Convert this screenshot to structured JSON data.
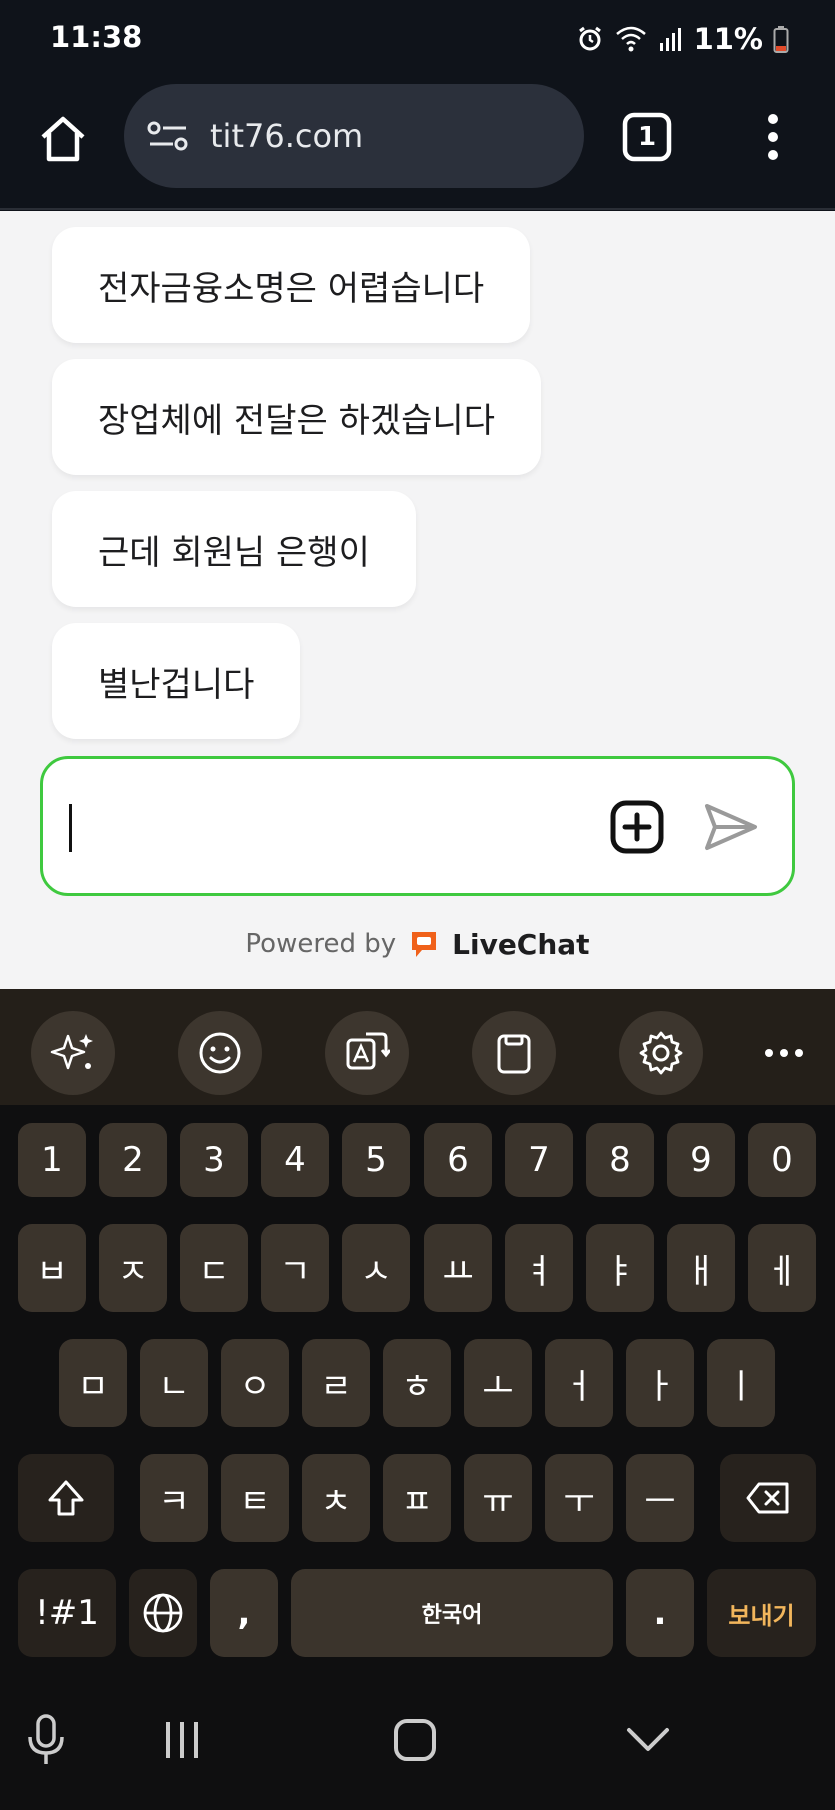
{
  "status": {
    "time": "11:38",
    "battery": "11%",
    "icons": [
      "alarm-icon",
      "wifi-icon",
      "signal-icon",
      "battery-icon"
    ]
  },
  "browser": {
    "url": "tit76.com",
    "tab_count": "1",
    "icons": [
      "home-icon",
      "site-settings-icon",
      "tabs-icon",
      "more-menu-icon"
    ]
  },
  "chat": {
    "messages": [
      {
        "text": "전자금융소명은 어렵습니다"
      },
      {
        "text": "장업체에 전달은 하겠습니다"
      },
      {
        "text": "근데 회원님 은행이"
      },
      {
        "text": "별난겁니다"
      }
    ],
    "input_value": "",
    "powered_by": "Powered by",
    "brand": "LiveChat",
    "colors": {
      "input_border": "#3fc93f",
      "brand": "#f0611a",
      "send_icon": "#9a9a9a"
    }
  },
  "keyboard": {
    "toolbar_icons": [
      "ai-sparkle-icon",
      "emoji-icon",
      "translate-icon",
      "clipboard-icon",
      "settings-icon",
      "more-icon"
    ],
    "row_numbers": [
      "1",
      "2",
      "3",
      "4",
      "5",
      "6",
      "7",
      "8",
      "9",
      "0"
    ],
    "row1": [
      "ㅂ",
      "ㅈ",
      "ㄷ",
      "ㄱ",
      "ㅅ",
      "ㅛ",
      "ㅕ",
      "ㅑ",
      "ㅐ",
      "ㅔ"
    ],
    "row2": [
      "ㅁ",
      "ㄴ",
      "ㅇ",
      "ㄹ",
      "ㅎ",
      "ㅗ",
      "ㅓ",
      "ㅏ",
      "ㅣ"
    ],
    "row3": [
      "ㅋ",
      "ㅌ",
      "ㅊ",
      "ㅍ",
      "ㅠ",
      "ㅜ",
      "ㅡ"
    ],
    "symbols_key": "!#1",
    "comma_key": ",",
    "space_key": "한국어",
    "period_key": ".",
    "send_key": "보내기",
    "colors": {
      "key": "#3b342c",
      "key_dark": "#27221d",
      "send_text": "#f2b65c",
      "toolbar": "#241f19"
    }
  },
  "navigation": {
    "icons": [
      "microphone-icon",
      "recent-apps-icon",
      "home-nav-icon",
      "back-chevron-icon"
    ]
  }
}
